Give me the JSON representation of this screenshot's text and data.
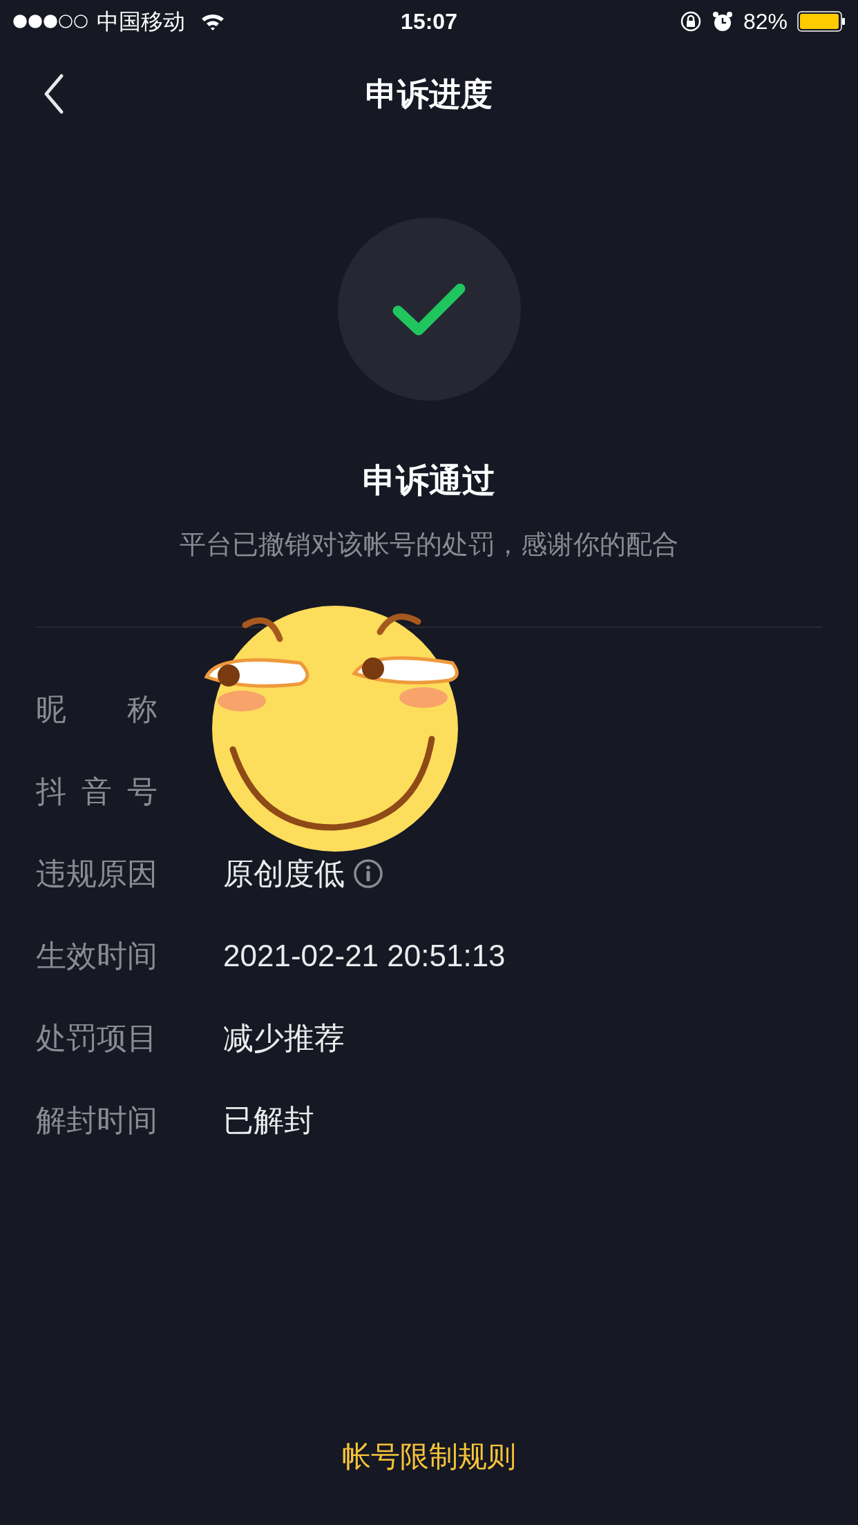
{
  "status_bar": {
    "carrier": "中国移动",
    "time": "15:07",
    "battery": "82%"
  },
  "nav": {
    "title": "申诉进度"
  },
  "result": {
    "title": "申诉通过",
    "message": "平台已撤销对该帐号的处罚，感谢你的配合"
  },
  "details": [
    {
      "label": "昵称"
    },
    {
      "label": "抖音号"
    },
    {
      "label": "违规原因",
      "value": "原创度低",
      "info_icon": true
    },
    {
      "label": "生效时间",
      "value": "2021-02-21 20:51:13",
      "info_icon": false
    },
    {
      "label": "处罚项目",
      "value": "减少推荐",
      "info_icon": false
    },
    {
      "label": "解封时间",
      "value": "已解封",
      "info_icon": false
    }
  ],
  "footer": {
    "link": "帐号限制规则"
  }
}
